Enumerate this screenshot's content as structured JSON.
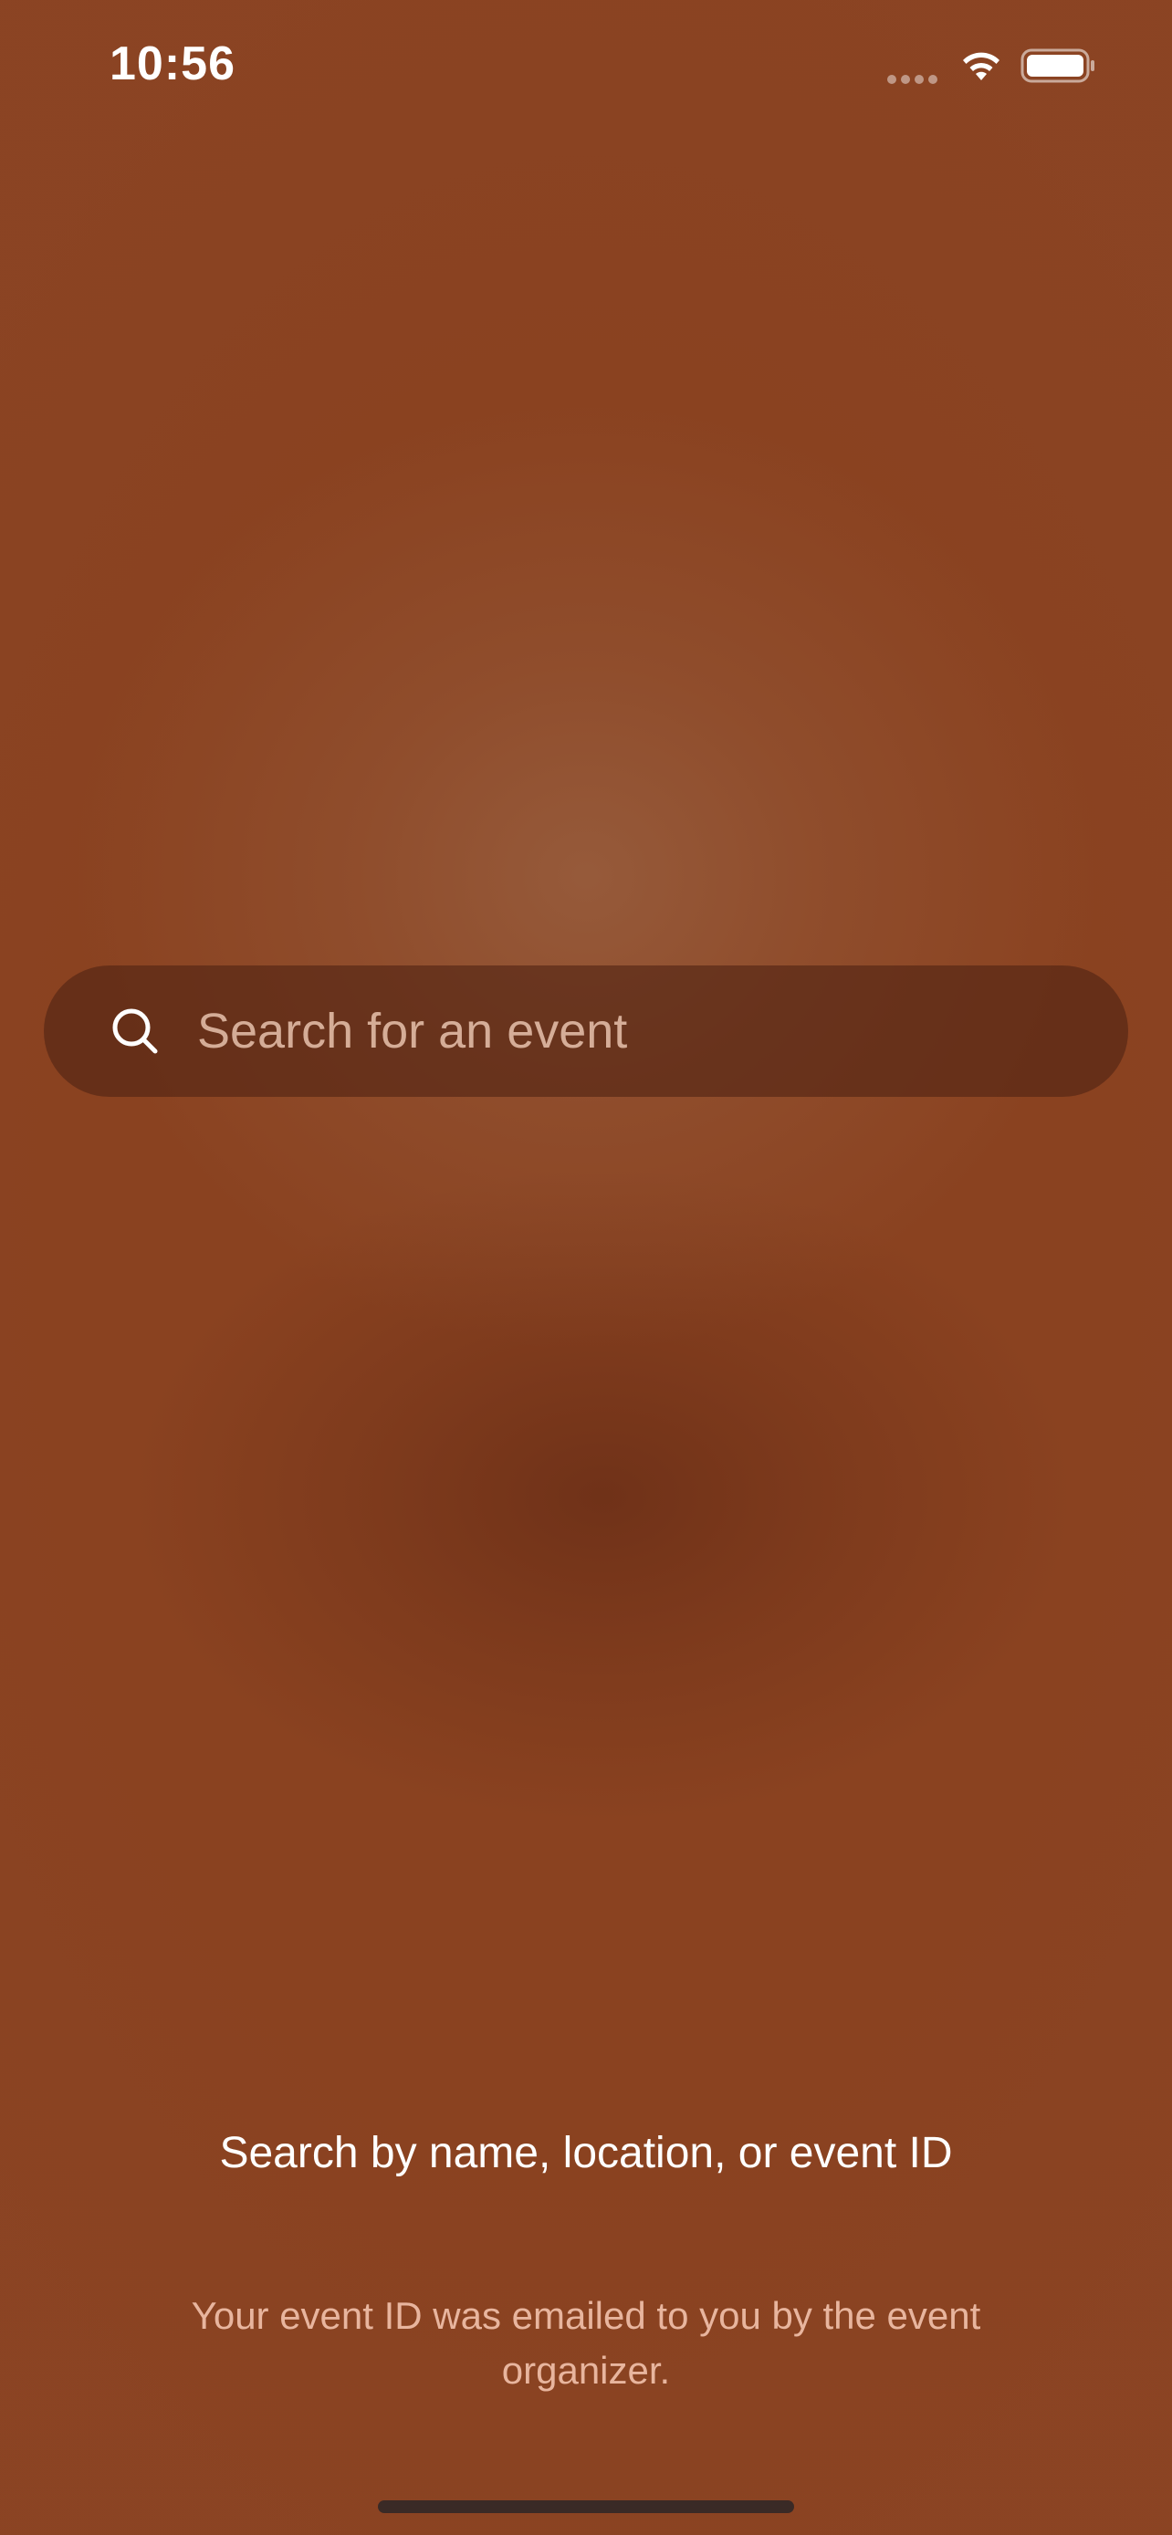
{
  "status_bar": {
    "time": "10:56",
    "icons": [
      "signal-dots-icon",
      "wifi-icon",
      "battery-icon"
    ]
  },
  "search": {
    "placeholder": "Search for an event",
    "value": "",
    "icon": "search-icon"
  },
  "hint": {
    "title": "Search by name, location, or event ID",
    "subtitle": "Your event ID was emailed to you by the event organizer."
  },
  "colors": {
    "background": "#8a4220",
    "search_bar": "#5a2d1b",
    "text_primary": "#ffffff",
    "text_secondary": "#f0c8b4"
  }
}
